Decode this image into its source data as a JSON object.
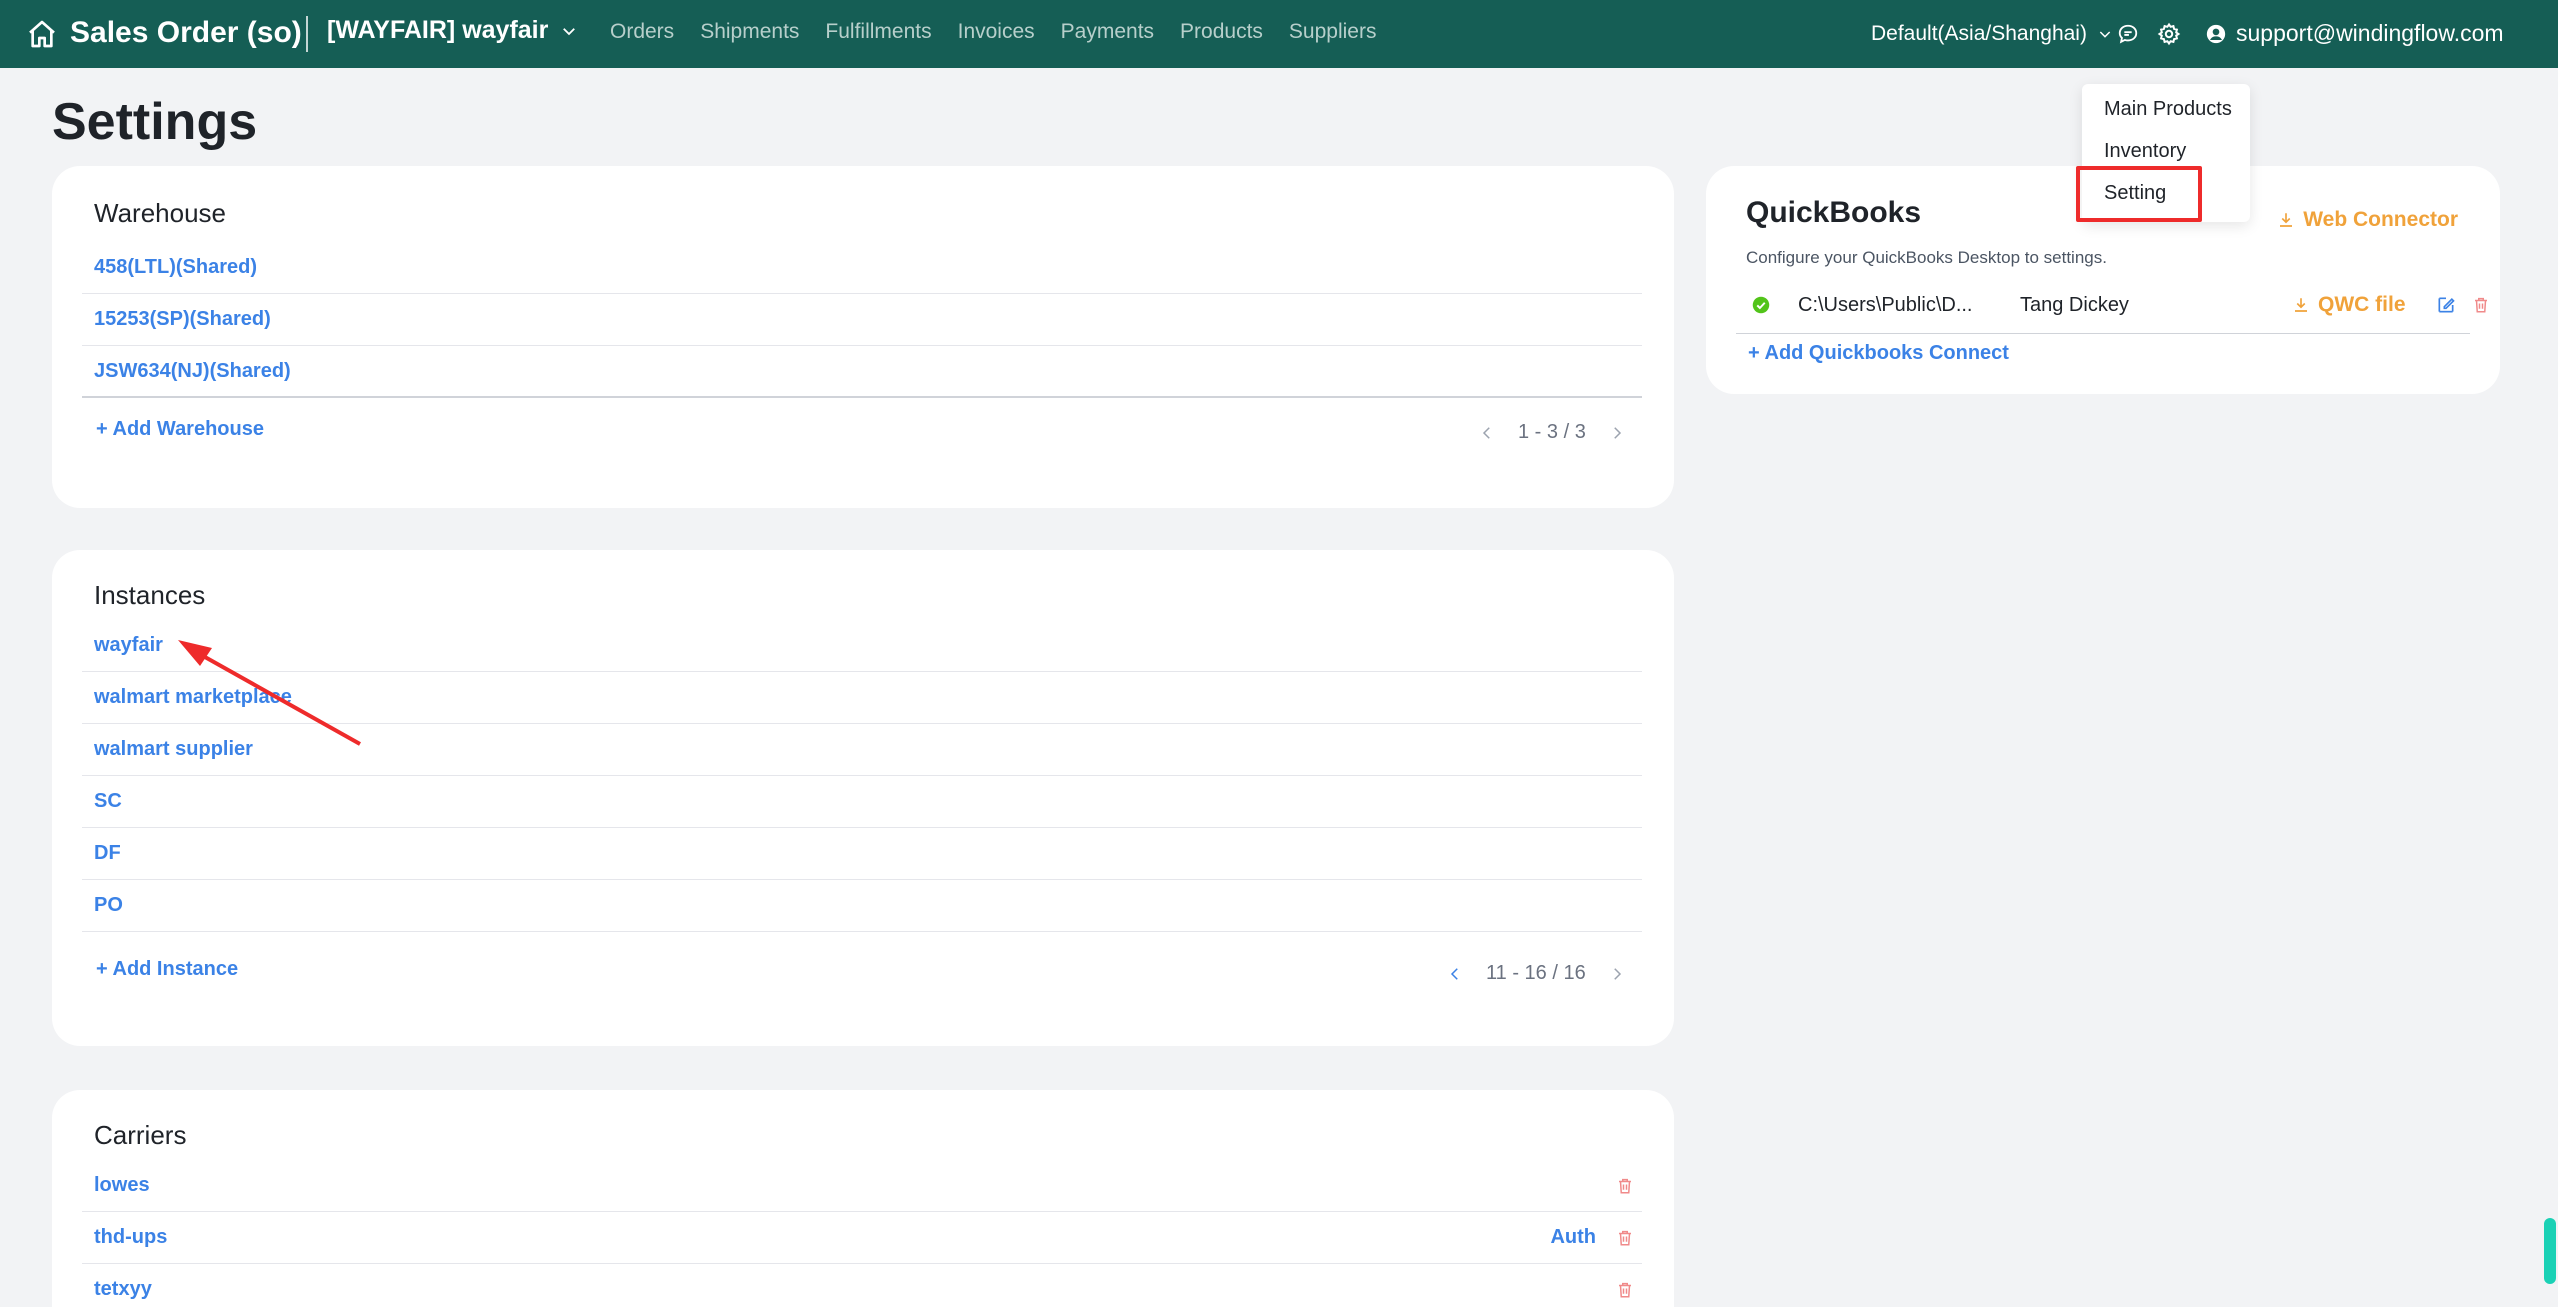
{
  "header": {
    "app_title": "Sales Order (so)",
    "instance_label": "[WAYFAIR] wayfair",
    "nav_items": [
      "Orders",
      "Shipments",
      "Fulfillments",
      "Invoices",
      "Payments",
      "Products",
      "Suppliers"
    ],
    "timezone": "Default(Asia/Shanghai)",
    "user_email": "support@windingflow.com"
  },
  "page_title": "Settings",
  "warehouse": {
    "title": "Warehouse",
    "items": [
      "458(LTL)(Shared)",
      "15253(SP)(Shared)",
      "JSW634(NJ)(Shared)"
    ],
    "add_label": "+ Add Warehouse",
    "pager_text": "1 - 3 / 3"
  },
  "instances": {
    "title": "Instances",
    "items": [
      "wayfair",
      "walmart marketplace",
      "walmart supplier",
      "SC",
      "DF",
      "PO"
    ],
    "add_label": "+ Add Instance",
    "pager_text": "11 - 16 / 16"
  },
  "carriers": {
    "title": "Carriers",
    "items": [
      {
        "name": "lowes",
        "auth": ""
      },
      {
        "name": "thd-ups",
        "auth": "Auth"
      },
      {
        "name": "tetxyy",
        "auth": ""
      }
    ]
  },
  "quickbooks": {
    "title": "QuickBooks",
    "web_connector_label": "Web Connector",
    "description": "Configure your QuickBooks Desktop to settings.",
    "connection": {
      "path": "C:\\Users\\Public\\D...",
      "user": "Tang Dickey",
      "qwc_label": "QWC file"
    },
    "add_label": "+ Add Quickbooks Connect"
  },
  "settings_menu": {
    "items": [
      "Main Products",
      "Inventory",
      "Setting"
    ],
    "highlighted": "Setting"
  },
  "colors": {
    "header_bg": "#155e55",
    "link": "#3b82e6",
    "accent_orange": "#f0a23a",
    "annotation_red": "#ee2b2b",
    "success_green": "#52c41a",
    "danger_pink": "#f08a8a"
  }
}
